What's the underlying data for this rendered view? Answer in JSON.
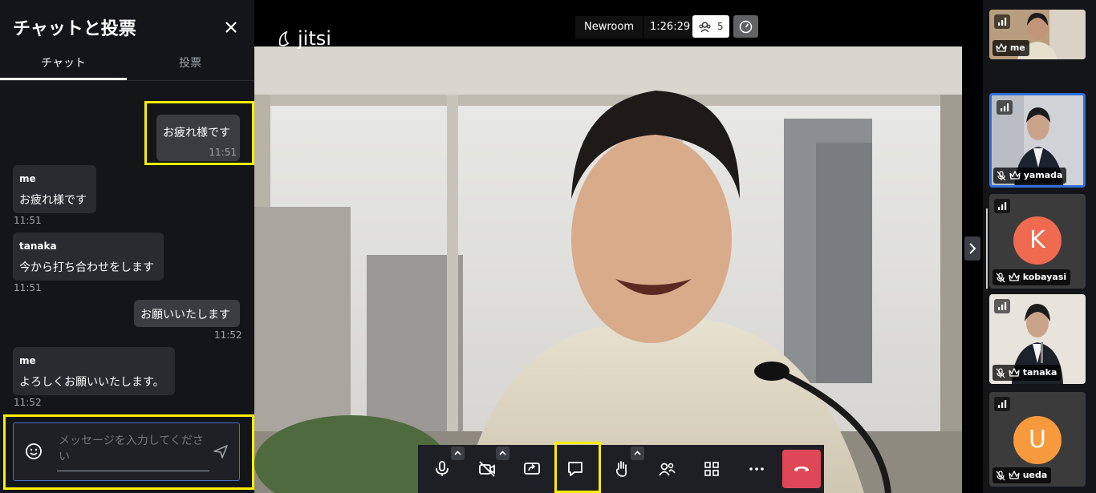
{
  "chat": {
    "title": "チャットと投票",
    "tabs": [
      {
        "label": "チャット"
      },
      {
        "label": "投票"
      }
    ],
    "messages": [
      {
        "sender": "",
        "text": "お疲れ様です",
        "time": "11:51"
      },
      {
        "sender": "me",
        "text": "お疲れ様です",
        "time": "11:51"
      },
      {
        "sender": "tanaka",
        "text": "今から打ち合わせをします",
        "time": "11:51"
      },
      {
        "sender": "",
        "text": "お願いいたします",
        "time": "11:52"
      },
      {
        "sender": "me",
        "text": "よろしくお願いいたします。",
        "time": "11:52"
      }
    ],
    "input_placeholder": "メッセージを入力してください"
  },
  "header": {
    "logo": "jitsi",
    "room_name": "Newroom",
    "duration": "1:26:29",
    "participant_count": "5"
  },
  "filmstrip": {
    "participants": [
      {
        "name": "me"
      },
      {
        "name": "yamada"
      },
      {
        "name": "kobayasi",
        "initial": "K",
        "color": "#f06a50"
      },
      {
        "name": "tanaka"
      },
      {
        "name": "ueda",
        "initial": "U",
        "color": "#f79a3e"
      }
    ]
  },
  "colors": {
    "highlight": "#ffee00",
    "hangup": "#e04757",
    "active_tile_border": "#2f6fde"
  }
}
